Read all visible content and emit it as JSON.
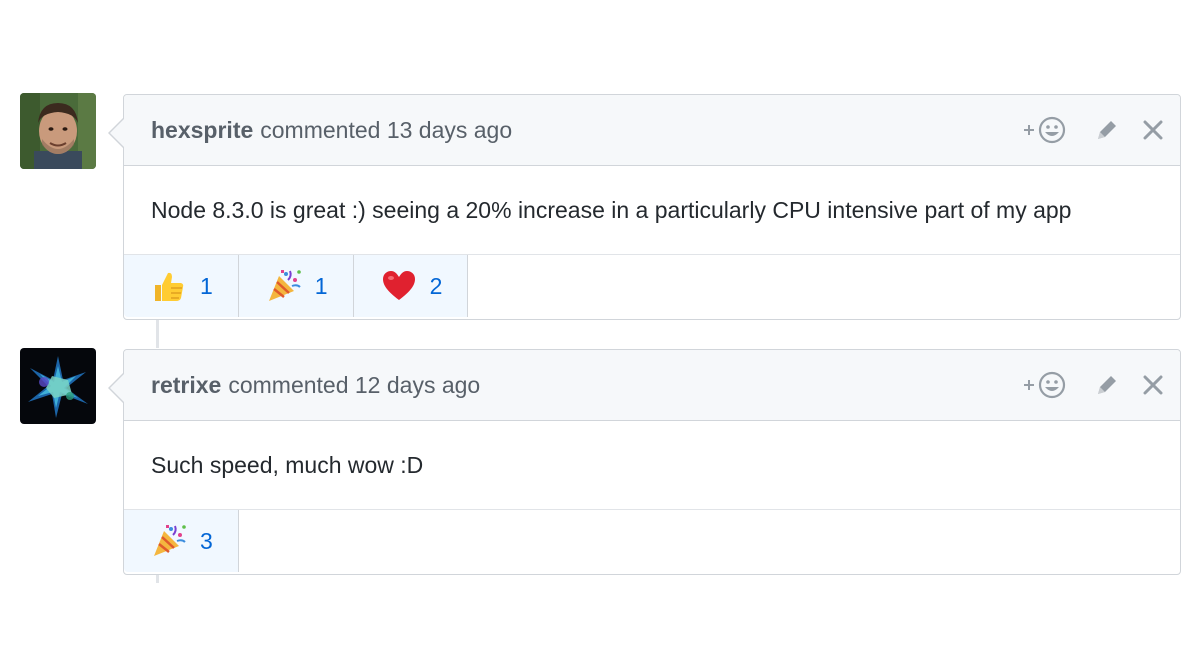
{
  "comments": [
    {
      "author": "hexsprite",
      "action_text": "commented 13 days ago",
      "body": "Node 8.3.0 is great :) seeing a 20% increase in a particularly CPU intensive part of my app",
      "reactions": [
        {
          "icon": "thumbs-up-icon",
          "count": "1"
        },
        {
          "icon": "party-popper-icon",
          "count": "1"
        },
        {
          "icon": "heart-icon",
          "count": "2"
        }
      ]
    },
    {
      "author": "retrixe",
      "action_text": "commented 12 days ago",
      "body": "Such speed, much wow :D",
      "reactions": [
        {
          "icon": "party-popper-icon",
          "count": "3"
        }
      ]
    }
  ],
  "header_actions": [
    "add-reaction-icon",
    "pencil-icon",
    "close-icon"
  ],
  "colors": {
    "header_bg": "#f6f8fa",
    "border": "#d1d5da",
    "reaction_bg": "#f1f8ff",
    "count_color": "#0366d6",
    "muted_text": "#586069"
  }
}
